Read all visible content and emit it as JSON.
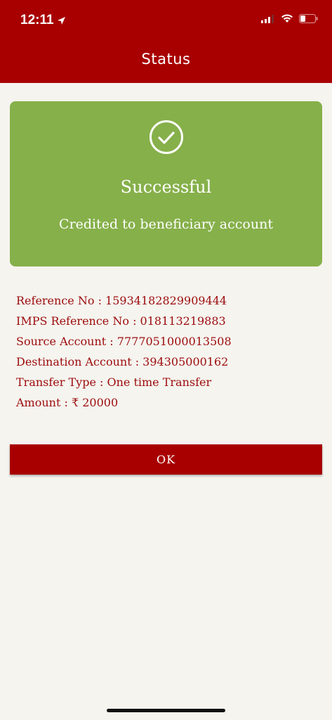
{
  "status_bar": {
    "time": "12:11"
  },
  "header": {
    "title": "Status"
  },
  "result": {
    "title": "Successful",
    "subtitle": "Credited to beneficiary account"
  },
  "details": [
    "Reference No : 15934182829909444",
    "IMPS Reference No : 018113219883",
    "Source Account : 7777051000013508",
    "Destination Account : 394305000162",
    "Transfer Type : One time Transfer",
    "Amount : ₹ 20000"
  ],
  "actions": {
    "ok_label": "OK"
  },
  "colors": {
    "header": "#a80000",
    "success_card": "#86b04a",
    "detail_text": "#9c0c0c",
    "background": "#f5f4ef"
  }
}
